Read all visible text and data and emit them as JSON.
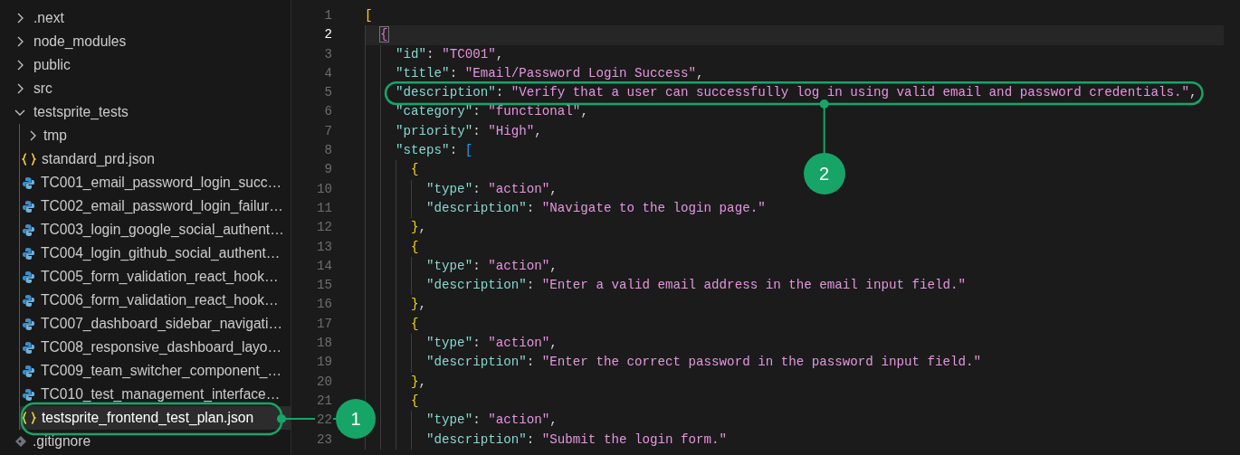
{
  "explorer": {
    "items": [
      {
        "kind": "folder",
        "label": ".next",
        "expanded": false,
        "selected": false
      },
      {
        "kind": "folder",
        "label": "node_modules",
        "expanded": false,
        "selected": false
      },
      {
        "kind": "folder",
        "label": "public",
        "expanded": false,
        "selected": false
      },
      {
        "kind": "folder",
        "label": "src",
        "expanded": false,
        "selected": false
      },
      {
        "kind": "folder",
        "label": "testsprite_tests",
        "expanded": true,
        "selected": false,
        "children": [
          {
            "kind": "folder",
            "label": "tmp",
            "expanded": false,
            "selected": false
          },
          {
            "kind": "json",
            "label": "standard_prd.json",
            "selected": false
          },
          {
            "kind": "python",
            "label": "TC001_email_password_login_succ…",
            "selected": false
          },
          {
            "kind": "python",
            "label": "TC002_email_password_login_failur…",
            "selected": false
          },
          {
            "kind": "python",
            "label": "TC003_login_google_social_authent…",
            "selected": false
          },
          {
            "kind": "python",
            "label": "TC004_login_github_social_authent…",
            "selected": false
          },
          {
            "kind": "python",
            "label": "TC005_form_validation_react_hook…",
            "selected": false
          },
          {
            "kind": "python",
            "label": "TC006_form_validation_react_hook…",
            "selected": false
          },
          {
            "kind": "python",
            "label": "TC007_dashboard_sidebar_navigati…",
            "selected": false
          },
          {
            "kind": "python",
            "label": "TC008_responsive_dashboard_layo…",
            "selected": false
          },
          {
            "kind": "python",
            "label": "TC009_team_switcher_component_…",
            "selected": false
          },
          {
            "kind": "python",
            "label": "TC010_test_management_interface…",
            "selected": false
          },
          {
            "kind": "json",
            "label": "testsprite_frontend_test_plan.json",
            "selected": true,
            "callout": "1"
          }
        ]
      },
      {
        "kind": "git",
        "label": ".gitignore",
        "selected": false
      }
    ]
  },
  "editor": {
    "lines": [
      {
        "number": "1",
        "current": false,
        "tokens": [
          {
            "kind": "bracket",
            "text": "[",
            "color": "#ffd700"
          }
        ]
      },
      {
        "number": "2",
        "current": true,
        "tokens": [
          {
            "kind": "bracket",
            "text": "{",
            "color": "#da70d6",
            "matched": true
          }
        ]
      },
      {
        "number": "3",
        "current": false,
        "tokens": [
          {
            "kind": "key",
            "text": "\"id\""
          },
          {
            "kind": "punct",
            "text": ": "
          },
          {
            "kind": "string",
            "text": "\"TC001\""
          },
          {
            "kind": "punct",
            "text": ","
          }
        ]
      },
      {
        "number": "4",
        "current": false,
        "tokens": [
          {
            "kind": "key",
            "text": "\"title\""
          },
          {
            "kind": "punct",
            "text": ": "
          },
          {
            "kind": "string",
            "text": "\"Email/Password Login Success\""
          },
          {
            "kind": "punct",
            "text": ","
          }
        ]
      },
      {
        "number": "5",
        "current": false,
        "callout": "2",
        "tokens": [
          {
            "kind": "key",
            "text": "\"description\""
          },
          {
            "kind": "punct",
            "text": ": "
          },
          {
            "kind": "string",
            "text": "\"Verify that a user can successfully log in using valid email and password credentials.\""
          },
          {
            "kind": "punct",
            "text": ","
          }
        ]
      },
      {
        "number": "6",
        "current": false,
        "tokens": [
          {
            "kind": "key",
            "text": "\"category\""
          },
          {
            "kind": "punct",
            "text": ": "
          },
          {
            "kind": "string",
            "text": "\"functional\""
          },
          {
            "kind": "punct",
            "text": ","
          }
        ]
      },
      {
        "number": "7",
        "current": false,
        "tokens": [
          {
            "kind": "key",
            "text": "\"priority\""
          },
          {
            "kind": "punct",
            "text": ": "
          },
          {
            "kind": "string",
            "text": "\"High\""
          },
          {
            "kind": "punct",
            "text": ","
          }
        ]
      },
      {
        "number": "8",
        "current": false,
        "tokens": [
          {
            "kind": "key",
            "text": "\"steps\""
          },
          {
            "kind": "punct",
            "text": ": "
          },
          {
            "kind": "bracket",
            "text": "[",
            "color": "#179fff"
          }
        ]
      },
      {
        "number": "9",
        "current": false,
        "tokens": [
          {
            "kind": "bracket",
            "text": "{",
            "color": "#ffd700"
          }
        ]
      },
      {
        "number": "10",
        "current": false,
        "tokens": [
          {
            "kind": "key",
            "text": "\"type\""
          },
          {
            "kind": "punct",
            "text": ": "
          },
          {
            "kind": "string",
            "text": "\"action\""
          },
          {
            "kind": "punct",
            "text": ","
          }
        ]
      },
      {
        "number": "11",
        "current": false,
        "tokens": [
          {
            "kind": "key",
            "text": "\"description\""
          },
          {
            "kind": "punct",
            "text": ": "
          },
          {
            "kind": "string",
            "text": "\"Navigate to the login page.\""
          }
        ]
      },
      {
        "number": "12",
        "current": false,
        "tokens": [
          {
            "kind": "bracket",
            "text": "}",
            "color": "#ffd700"
          },
          {
            "kind": "punct",
            "text": ","
          }
        ]
      },
      {
        "number": "13",
        "current": false,
        "tokens": [
          {
            "kind": "bracket",
            "text": "{",
            "color": "#ffd700"
          }
        ]
      },
      {
        "number": "14",
        "current": false,
        "tokens": [
          {
            "kind": "key",
            "text": "\"type\""
          },
          {
            "kind": "punct",
            "text": ": "
          },
          {
            "kind": "string",
            "text": "\"action\""
          },
          {
            "kind": "punct",
            "text": ","
          }
        ]
      },
      {
        "number": "15",
        "current": false,
        "tokens": [
          {
            "kind": "key",
            "text": "\"description\""
          },
          {
            "kind": "punct",
            "text": ": "
          },
          {
            "kind": "string",
            "text": "\"Enter a valid email address in the email input field.\""
          }
        ]
      },
      {
        "number": "16",
        "current": false,
        "tokens": [
          {
            "kind": "bracket",
            "text": "}",
            "color": "#ffd700"
          },
          {
            "kind": "punct",
            "text": ","
          }
        ]
      },
      {
        "number": "17",
        "current": false,
        "tokens": [
          {
            "kind": "bracket",
            "text": "{",
            "color": "#ffd700"
          }
        ]
      },
      {
        "number": "18",
        "current": false,
        "tokens": [
          {
            "kind": "key",
            "text": "\"type\""
          },
          {
            "kind": "punct",
            "text": ": "
          },
          {
            "kind": "string",
            "text": "\"action\""
          },
          {
            "kind": "punct",
            "text": ","
          }
        ]
      },
      {
        "number": "19",
        "current": false,
        "tokens": [
          {
            "kind": "key",
            "text": "\"description\""
          },
          {
            "kind": "punct",
            "text": ": "
          },
          {
            "kind": "string",
            "text": "\"Enter the correct password in the password input field.\""
          }
        ]
      },
      {
        "number": "20",
        "current": false,
        "tokens": [
          {
            "kind": "bracket",
            "text": "}",
            "color": "#ffd700"
          },
          {
            "kind": "punct",
            "text": ","
          }
        ]
      },
      {
        "number": "21",
        "current": false,
        "tokens": [
          {
            "kind": "bracket",
            "text": "{",
            "color": "#ffd700"
          }
        ]
      },
      {
        "number": "22",
        "current": false,
        "tokens": [
          {
            "kind": "key",
            "text": "\"type\""
          },
          {
            "kind": "punct",
            "text": ": "
          },
          {
            "kind": "string",
            "text": "\"action\""
          },
          {
            "kind": "punct",
            "text": ","
          }
        ]
      },
      {
        "number": "23",
        "current": false,
        "tokens": [
          {
            "kind": "key",
            "text": "\"description\""
          },
          {
            "kind": "punct",
            "text": ": "
          },
          {
            "kind": "string",
            "text": "\"Submit the login form.\""
          }
        ]
      }
    ]
  }
}
